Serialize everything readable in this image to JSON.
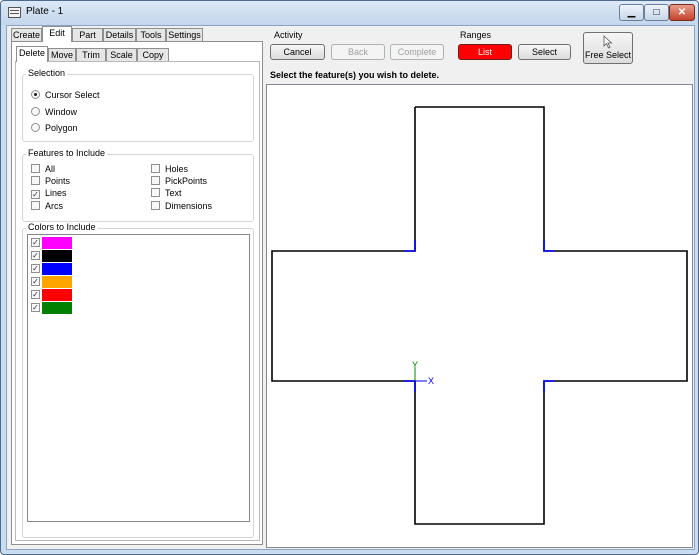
{
  "window": {
    "title": "Plate - 1"
  },
  "title_buttons": {
    "minimize": "▁",
    "maximize": "□",
    "close": "✕"
  },
  "main_tabs": [
    "Create",
    "Edit",
    "Part",
    "Details",
    "Tools",
    "Settings"
  ],
  "main_tab_active": "Edit",
  "edit_tabs": [
    "Delete",
    "Move",
    "Trim",
    "Scale",
    "Copy"
  ],
  "edit_tab_active": "Delete",
  "selection": {
    "legend": "Selection",
    "options": [
      {
        "label": "Cursor Select",
        "selected": true
      },
      {
        "label": "Window",
        "selected": false
      },
      {
        "label": "Polygon",
        "selected": false
      }
    ]
  },
  "features": {
    "legend": "Features to Include",
    "items": [
      {
        "label": "All",
        "checked": false
      },
      {
        "label": "Points",
        "checked": false
      },
      {
        "label": "Lines",
        "checked": true
      },
      {
        "label": "Arcs",
        "checked": false
      },
      {
        "label": "Holes",
        "checked": false
      },
      {
        "label": "PickPoints",
        "checked": false
      },
      {
        "label": "Text",
        "checked": false
      },
      {
        "label": "Dimensions",
        "checked": false
      }
    ]
  },
  "colors": {
    "legend": "Colors to Include",
    "items": [
      {
        "color": "#ff00ff",
        "checked": true
      },
      {
        "color": "#000000",
        "checked": true
      },
      {
        "color": "#0000ff",
        "checked": true
      },
      {
        "color": "#ffa500",
        "checked": true
      },
      {
        "color": "#ff0000",
        "checked": true
      },
      {
        "color": "#008000",
        "checked": true
      }
    ]
  },
  "activity": {
    "label": "Activity",
    "cancel": "Cancel",
    "back": "Back",
    "complete": "Complete"
  },
  "ranges": {
    "label": "Ranges",
    "list": "List",
    "select": "Select"
  },
  "free_select": {
    "label": "Free Select",
    "icon": "cursor-icon"
  },
  "prompt": "Select the feature(s) you wish to delete.",
  "canvas": {
    "shape": "cross",
    "outline_color": "#000000",
    "highlight_color": "#0000ff",
    "axis_x_label": "X",
    "axis_y_label": "Y",
    "axis_x_color": "#0000ff",
    "axis_y_color": "#008000"
  }
}
